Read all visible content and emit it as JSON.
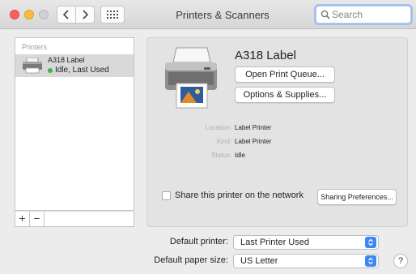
{
  "window": {
    "title": "Printers & Scanners"
  },
  "search": {
    "placeholder": "Search"
  },
  "sidebar": {
    "heading": "Printers",
    "printers": [
      {
        "name": "A318 Label",
        "status": "Idle, Last Used"
      }
    ],
    "add_label": "+",
    "remove_label": "−"
  },
  "detail": {
    "printer_name": "A318 Label",
    "open_queue_label": "Open Print Queue...",
    "options_label": "Options & Supplies...",
    "location_label": "Location:",
    "location_value": "Label Printer",
    "kind_label": "Kind:",
    "kind_value": "Label Printer",
    "status_label": "Status:",
    "status_value": "Idle",
    "share_label": "Share this printer on the network",
    "share_checked": false,
    "sharing_prefs_label": "Sharing Preferences..."
  },
  "defaults": {
    "printer_label": "Default printer:",
    "printer_value": "Last Printer Used",
    "paper_label": "Default paper size:",
    "paper_value": "US Letter"
  },
  "help_label": "?",
  "colors": {
    "accent": "#3b87f5",
    "status_idle": "#3cb54a",
    "close": "#fc605c",
    "minimize": "#fdbc40"
  },
  "icons": [
    "chevron-left-icon",
    "chevron-right-icon",
    "grid-icon",
    "search-icon",
    "printer-icon",
    "updown-arrows-icon"
  ]
}
